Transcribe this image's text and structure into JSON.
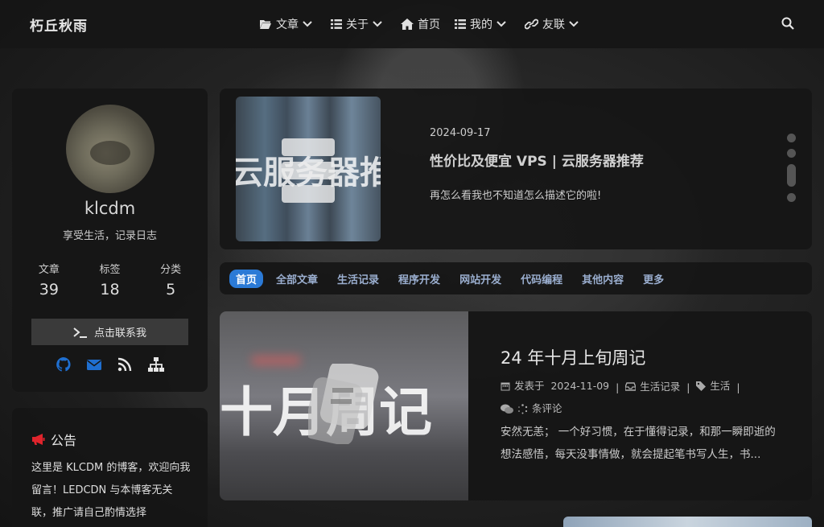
{
  "nav": {
    "brand": "朽丘秋雨",
    "items": [
      {
        "label": "文章",
        "icon": "folder-icon",
        "has_dropdown": true
      },
      {
        "label": "关于",
        "icon": "list-icon",
        "has_dropdown": true
      },
      {
        "label": "首页",
        "icon": "home-icon",
        "has_dropdown": false
      },
      {
        "label": "我的",
        "icon": "list-icon",
        "has_dropdown": true
      },
      {
        "label": "友联",
        "icon": "link-icon",
        "has_dropdown": true
      }
    ]
  },
  "profile": {
    "name": "klcdm",
    "description": "享受生活，记录日志",
    "stats": [
      {
        "label": "文章",
        "value": "39"
      },
      {
        "label": "标签",
        "value": "18"
      },
      {
        "label": "分类",
        "value": "5"
      }
    ],
    "contact_label": "点击联系我",
    "socials": [
      "github-icon",
      "envelope-icon",
      "rss-icon",
      "sitemap-icon"
    ]
  },
  "notice": {
    "title": "公告",
    "text": "这里是 KLCDM 的博客，欢迎向我留言！LEDCDN 与本博客无关联，推广请自己酌情选择"
  },
  "feature": {
    "image_text": "云服务器推荐",
    "date": "2024-09-17",
    "title": "性价比及便宜 VPS | 云服务器推荐",
    "summary": "再怎么看我也不知道怎么描述它的啦!"
  },
  "tabs": [
    "首页",
    "全部文章",
    "生活记录",
    "程序开发",
    "网站开发",
    "代码编程",
    "其他内容",
    "更多"
  ],
  "post": {
    "image_text": "十月周记",
    "title": "24 年十月上旬周记",
    "meta": {
      "published_label": "发表于",
      "date": "2024-11-09",
      "category": "生活记录",
      "tag": "生活",
      "comments_label": "条评论"
    },
    "summary": "安然无恙；  一个好习惯，在于懂得记录，和那一瞬即逝的想法感悟，每天没事情做，就会提起笔书写人生，书..."
  },
  "colors": {
    "accent": "#2b7ad6",
    "social": "#1f6fd0",
    "notice_icon": "#e0242c"
  }
}
